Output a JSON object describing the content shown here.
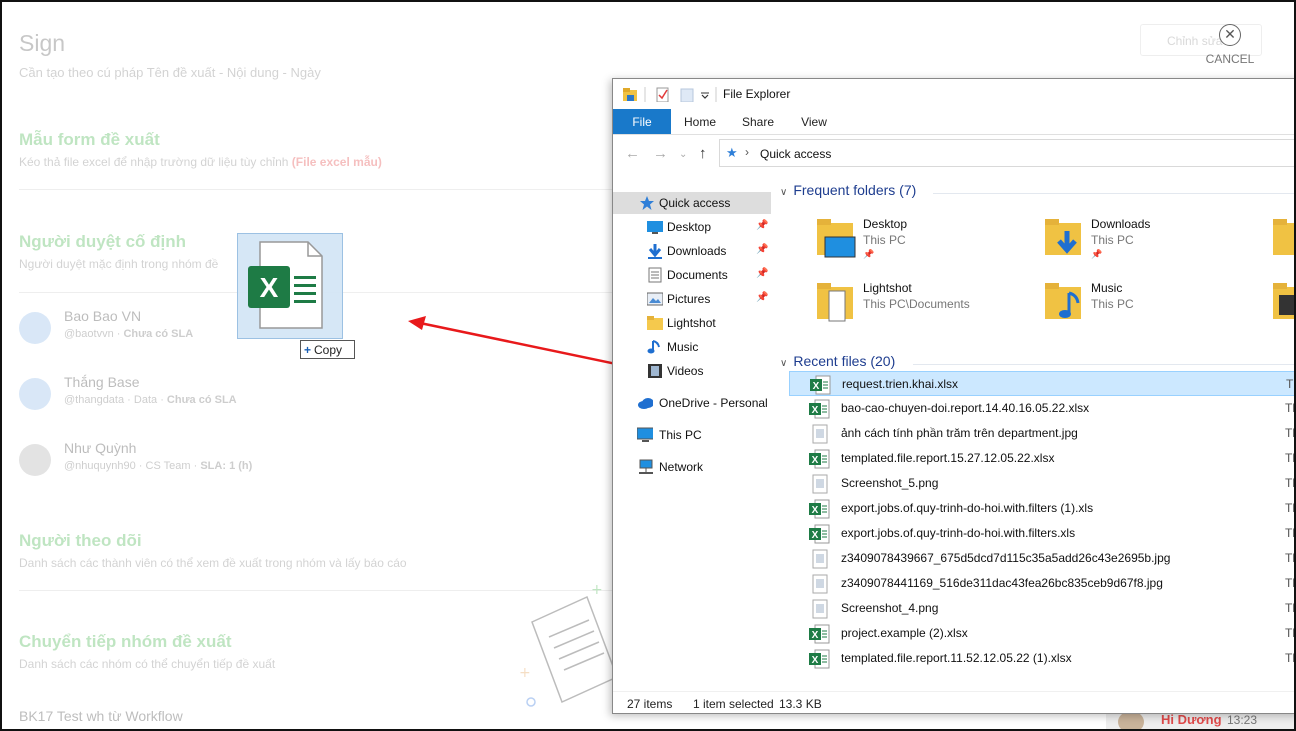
{
  "background_app": {
    "title": "Sign",
    "subtitle": "Cần tạo theo cú pháp Tên đề xuất - Nội dung - Ngày",
    "edit_button": "Chỉnh sửa",
    "cancel_label": "CANCEL",
    "sections": {
      "form": {
        "title": "Mẫu form đề xuất",
        "desc": "Kéo thả file excel để nhập trường dữ liệu tùy chỉnh",
        "link": "(File excel mẫu)"
      },
      "approvers": {
        "title": "Người duyệt cố định",
        "desc": "Người duyệt mặc định trong nhóm đề"
      },
      "followers": {
        "title": "Người theo dõi",
        "desc": "Danh sách các thành viên có thể xem đề xuất trong nhóm và lấy báo cáo"
      },
      "forward": {
        "title": "Chuyển tiếp nhóm đề xuất",
        "desc": "Danh sách các nhóm có thể chuyển tiếp đề xuất"
      }
    },
    "people": [
      {
        "name": "Bao Bao VN",
        "handle": "@baotvvn",
        "team": "",
        "sla": "Chưa có SLA"
      },
      {
        "name": "Thắng Base",
        "handle": "@thangdata",
        "team": "Data",
        "sla": "Chưa có SLA"
      },
      {
        "name": "Như Quỳnh",
        "handle": "@nhuquynh90",
        "team": "CS Team",
        "sla": "SLA: 1 (h)"
      }
    ],
    "last_item": "BK17 Test wh từ Workflow",
    "chat": {
      "name": "Hi Dương",
      "time": "13:23"
    }
  },
  "drag": {
    "copy_label": "Copy"
  },
  "explorer": {
    "window_title": "File Explorer",
    "ribbon_tabs": [
      "File",
      "Home",
      "Share",
      "View"
    ],
    "address": "Quick access",
    "nav": [
      {
        "label": "Quick access",
        "icon": "star-icon"
      },
      {
        "label": "Desktop",
        "icon": "desktop-icon",
        "pinned": true
      },
      {
        "label": "Downloads",
        "icon": "download-icon",
        "pinned": true
      },
      {
        "label": "Documents",
        "icon": "documents-icon",
        "pinned": true
      },
      {
        "label": "Pictures",
        "icon": "pictures-icon",
        "pinned": true
      },
      {
        "label": "Lightshot",
        "icon": "folder-icon"
      },
      {
        "label": "Music",
        "icon": "music-icon"
      },
      {
        "label": "Videos",
        "icon": "videos-icon"
      },
      {
        "label": "OneDrive - Personal",
        "icon": "cloud-icon"
      },
      {
        "label": "This PC",
        "icon": "pc-icon"
      },
      {
        "label": "Network",
        "icon": "network-icon"
      }
    ],
    "frequent_title": "Frequent folders (7)",
    "frequent": [
      {
        "name": "Desktop",
        "sub": "This PC"
      },
      {
        "name": "Downloads",
        "sub": "This PC"
      },
      {
        "name": "Lightshot",
        "sub": "This PC\\Documents"
      },
      {
        "name": "Music",
        "sub": "This PC"
      }
    ],
    "recent_title": "Recent files (20)",
    "recent": [
      {
        "name": "request.trien.khai.xlsx",
        "icon": "excel-icon",
        "col": "Th"
      },
      {
        "name": "bao-cao-chuyen-doi.report.14.40.16.05.22.xlsx",
        "icon": "excel-icon",
        "col": "Th"
      },
      {
        "name": "ảnh cách tính phần trăm trên department.jpg",
        "icon": "image-icon",
        "col": "Th"
      },
      {
        "name": "templated.file.report.15.27.12.05.22.xlsx",
        "icon": "excel-icon",
        "col": "Th"
      },
      {
        "name": "Screenshot_5.png",
        "icon": "image-icon",
        "col": "Th"
      },
      {
        "name": "export.jobs.of.quy-trinh-do-hoi.with.filters (1).xls",
        "icon": "excel-icon",
        "col": "Th"
      },
      {
        "name": "export.jobs.of.quy-trinh-do-hoi.with.filters.xls",
        "icon": "excel-icon",
        "col": "Th"
      },
      {
        "name": "z3409078439667_675d5dcd7d115c35a5add26c43e2695b.jpg",
        "icon": "image-icon",
        "col": "Th"
      },
      {
        "name": "z3409078441169_516de311dac43fea26bc835ceb9d67f8.jpg",
        "icon": "image-icon",
        "col": "Th"
      },
      {
        "name": "Screenshot_4.png",
        "icon": "image-icon",
        "col": "Th"
      },
      {
        "name": "project.example (2).xlsx",
        "icon": "excel-icon",
        "col": "Th"
      },
      {
        "name": "templated.file.report.11.52.12.05.22 (1).xlsx",
        "icon": "excel-icon",
        "col": "Th"
      }
    ],
    "status": {
      "items": "27 items",
      "selected": "1 item selected",
      "size": "13.3 KB"
    }
  }
}
